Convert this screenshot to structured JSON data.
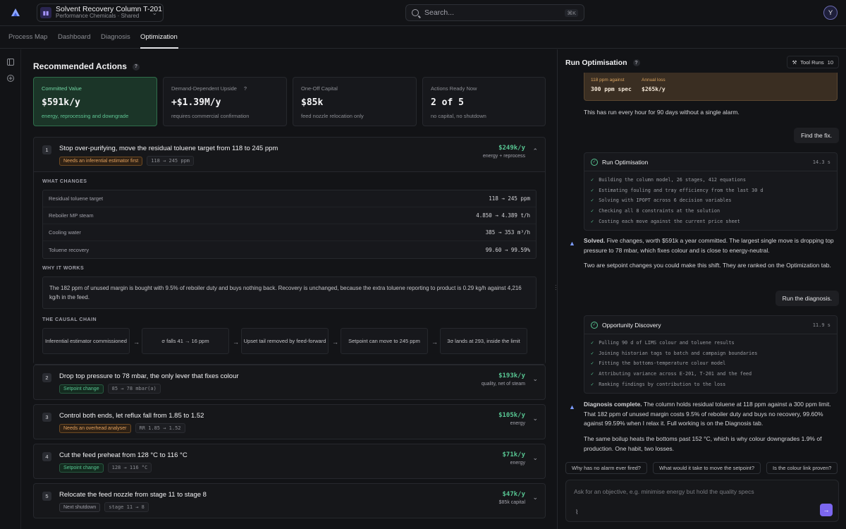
{
  "header": {
    "project_name": "Solvent Recovery Column T-201",
    "project_sub": "Performance Chemicals · Shared",
    "search_placeholder": "Search...",
    "search_shortcut": "⌘K",
    "avatar_initial": "Y"
  },
  "tabs": [
    {
      "label": "Process Map",
      "active": false
    },
    {
      "label": "Dashboard",
      "active": false
    },
    {
      "label": "Diagnosis",
      "active": false
    },
    {
      "label": "Optimization",
      "active": true
    }
  ],
  "main": {
    "title": "Recommended Actions",
    "help_glyph": "?",
    "kpis": [
      {
        "label": "Committed Value",
        "value": "$591k/y",
        "sub": "energy, reprocessing and downgrade",
        "highlight": true
      },
      {
        "label": "Demand-Dependent Upside",
        "value": "+$1.39M/y",
        "sub": "requires commercial confirmation",
        "has_help": true
      },
      {
        "label": "One-Off Capital",
        "value": "$85k",
        "sub": "feed nozzle relocation only"
      },
      {
        "label": "Actions Ready Now",
        "value": "2 of 5",
        "sub": "no capital, no shutdown"
      }
    ],
    "actions": [
      {
        "num": "1",
        "title": "Stop over-purifying, move the residual toluene target from 118 to 245 ppm",
        "tag": "Needs an inferential estimator first",
        "tag_style": "amber",
        "chip": "118 → 245 ppm",
        "value": "$249k/y",
        "value_sub": "energy + reprocess",
        "expanded": true,
        "detail": {
          "what_changes_label": "WHAT CHANGES",
          "changes": [
            {
              "name": "Residual toluene target",
              "value": "118 → 245 ppm"
            },
            {
              "name": "Reboiler MP steam",
              "value": "4.850 → 4.389 t/h"
            },
            {
              "name": "Cooling water",
              "value": "385 → 353 m³/h"
            },
            {
              "name": "Toluene recovery",
              "value": "99.60 → 99.59%"
            }
          ],
          "why_label": "WHY IT WORKS",
          "why_text": "The 182 ppm of unused margin is bought with 9.5% of reboiler duty and buys nothing back. Recovery is unchanged, because the extra toluene reporting to product is 0.29 kg/h against 4,216 kg/h in the feed.",
          "chain_label": "THE CAUSAL CHAIN",
          "chain": [
            "Inferential estimator commissioned",
            "σ falls 41 → 16 ppm",
            "Upset tail removed by feed-forward",
            "Setpoint can move to 245 ppm",
            "3σ lands at 293, inside the limit"
          ]
        }
      },
      {
        "num": "2",
        "title": "Drop top pressure to 78 mbar, the only lever that fixes colour",
        "tag": "Setpoint change",
        "tag_style": "green",
        "chip": "85 → 78 mbar(a)",
        "value": "$193k/y",
        "value_sub": "quality, net of steam"
      },
      {
        "num": "3",
        "title": "Control both ends, let reflux fall from 1.85 to 1.52",
        "tag": "Needs an overhead analyser",
        "tag_style": "amber",
        "chip": "RR 1.85 → 1.52",
        "value": "$105k/y",
        "value_sub": "energy"
      },
      {
        "num": "4",
        "title": "Cut the feed preheat from 128 °C to 116 °C",
        "tag": "Setpoint change",
        "tag_style": "green",
        "chip": "128 → 116 °C",
        "value": "$71k/y",
        "value_sub": "energy"
      },
      {
        "num": "5",
        "title": "Relocate the feed nozzle from stage 11 to stage 8",
        "tag": "Next shutdown",
        "tag_style": "gray",
        "chip": "stage 11 → 8",
        "value": "$47k/y",
        "value_sub": "$85k capital"
      }
    ]
  },
  "chat": {
    "title": "Run Optimisation",
    "tool_runs_label": "Tool Runs",
    "tool_runs_count": "10",
    "loss_card": {
      "left_label": "118 ppm against",
      "left_value": "300 ppm spec",
      "right_label": "Annual loss",
      "right_value": "$265k/y"
    },
    "msg_no_alarm": "This has run every hour for 90 days without a single alarm.",
    "user_msg_1": "Find the fix.",
    "tool_1": {
      "title": "Run Optimisation",
      "time": "14.3 s",
      "steps": [
        "Building the column model, 26 stages, 412 equations",
        "Estimating fouling and tray efficiency from the last 30 d",
        "Solving with IPOPT across 6 decision variables",
        "Checking all 8 constraints at the solution",
        "Costing each move against the current price sheet"
      ]
    },
    "solved_bold": "Solved.",
    "solved_text": " Five changes, worth $591k a year committed. The largest single move is dropping top pressure to 78 mbar, which fixes colour and is close to energy-neutral.",
    "setpoint_text": "Two are setpoint changes you could make this shift. They are ranked on the Optimization tab.",
    "user_msg_2": "Run the diagnosis.",
    "tool_2": {
      "title": "Opportunity Discovery",
      "time": "11.9 s",
      "steps": [
        "Pulling 90 d of LIMS colour and toluene results",
        "Joining historian tags to batch and campaign boundaries",
        "Fitting the bottoms-temperature colour model",
        "Attributing variance across E-201, T-201 and the feed",
        "Ranking findings by contribution to the loss"
      ]
    },
    "diag_bold": "Diagnosis complete.",
    "diag_text": " The column holds residual toluene at 118 ppm against a 300 ppm limit. That 182 ppm of unused margin costs 9.5% of reboiler duty and buys no recovery, 99.60% against 99.59% when I relax it. Full working is on the Diagnosis tab.",
    "boilup_text": "The same boilup heats the bottoms past 152 °C, which is why colour downgrades 1.9% of production. One habit, two losses.",
    "suggestions": [
      "Why has no alarm ever fired?",
      "What would it take to move the setpoint?",
      "Is the colour link proven?"
    ],
    "composer_placeholder": "Ask for an objective, e.g. minimise energy but hold the quality specs"
  }
}
